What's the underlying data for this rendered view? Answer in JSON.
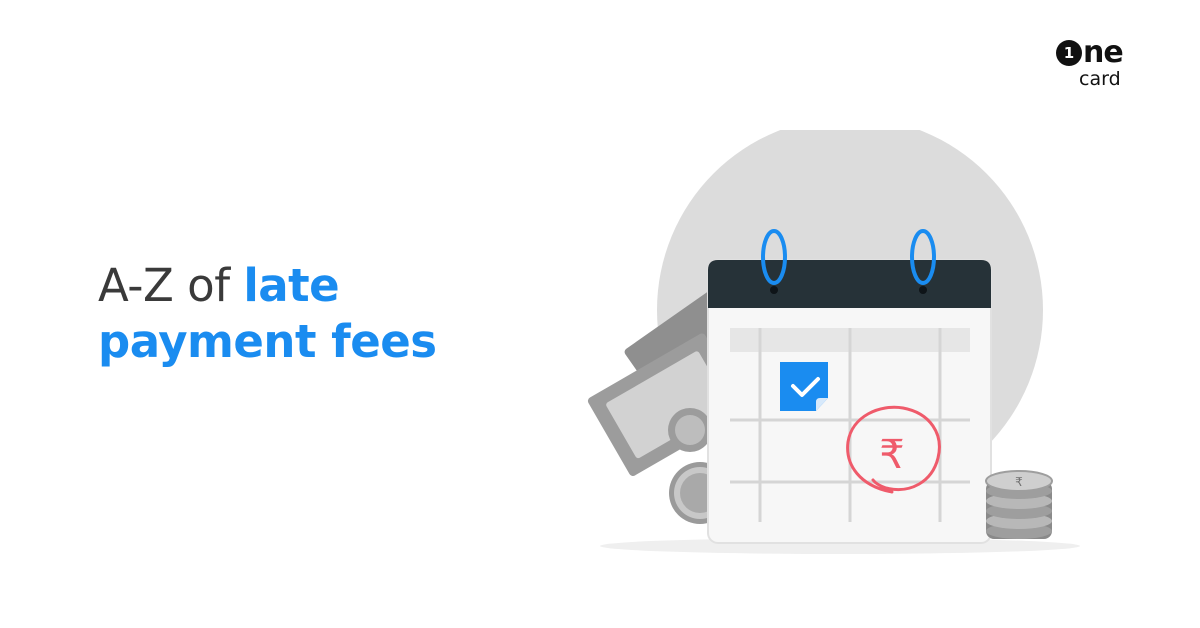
{
  "brand": {
    "badge": "1",
    "word": "ne",
    "sub": "card"
  },
  "headline": {
    "line1_plain": "A-Z of ",
    "line1_accent": "late",
    "line2_accent": "payment fees"
  },
  "illustration": {
    "currency_symbol": "₹"
  },
  "colors": {
    "accent": "#1a8cf0",
    "calendar_header": "#263238",
    "circle_mark": "#ef5b6b",
    "background_circle": "#dcdcdc"
  }
}
